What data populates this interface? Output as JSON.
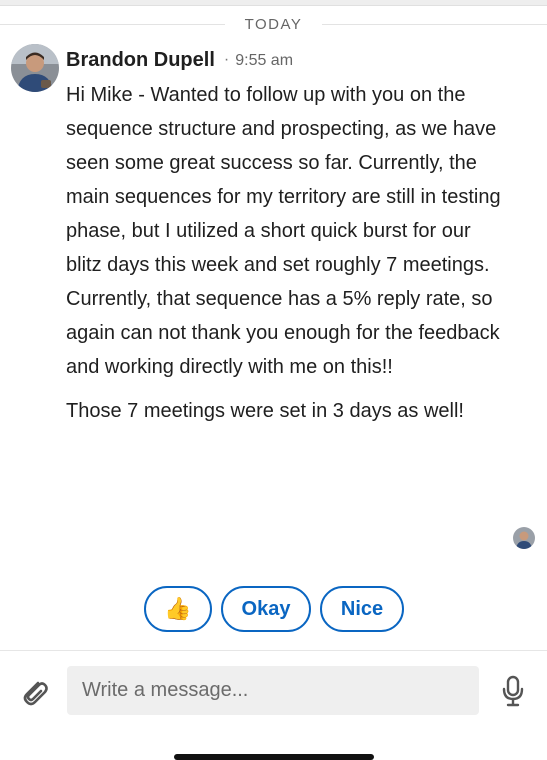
{
  "date_divider": "TODAY",
  "message": {
    "sender": "Brandon Dupell",
    "separator": "·",
    "time": "9:55 am",
    "paragraphs": [
      "Hi Mike - Wanted to follow up with you on the sequence structure and prospecting, as we have seen some great success so far. Currently, the main sequences for my territory are still in testing phase, but I utilized a short quick burst for our blitz days this week and set roughly 7 meetings.  Currently, that sequence has a 5% reply rate, so again can not thank you enough for the feedback and working directly with me on this!!",
      "Those 7 meetings were set in 3 days as well!"
    ]
  },
  "quick_replies": {
    "thumb": "👍",
    "okay": "Okay",
    "nice": "Nice"
  },
  "composer": {
    "placeholder": "Write a message..."
  },
  "icons": {
    "attach": "paperclip-icon",
    "mic": "microphone-icon"
  },
  "colors": {
    "accent": "#0a66c2",
    "input_bg": "#efefef"
  }
}
